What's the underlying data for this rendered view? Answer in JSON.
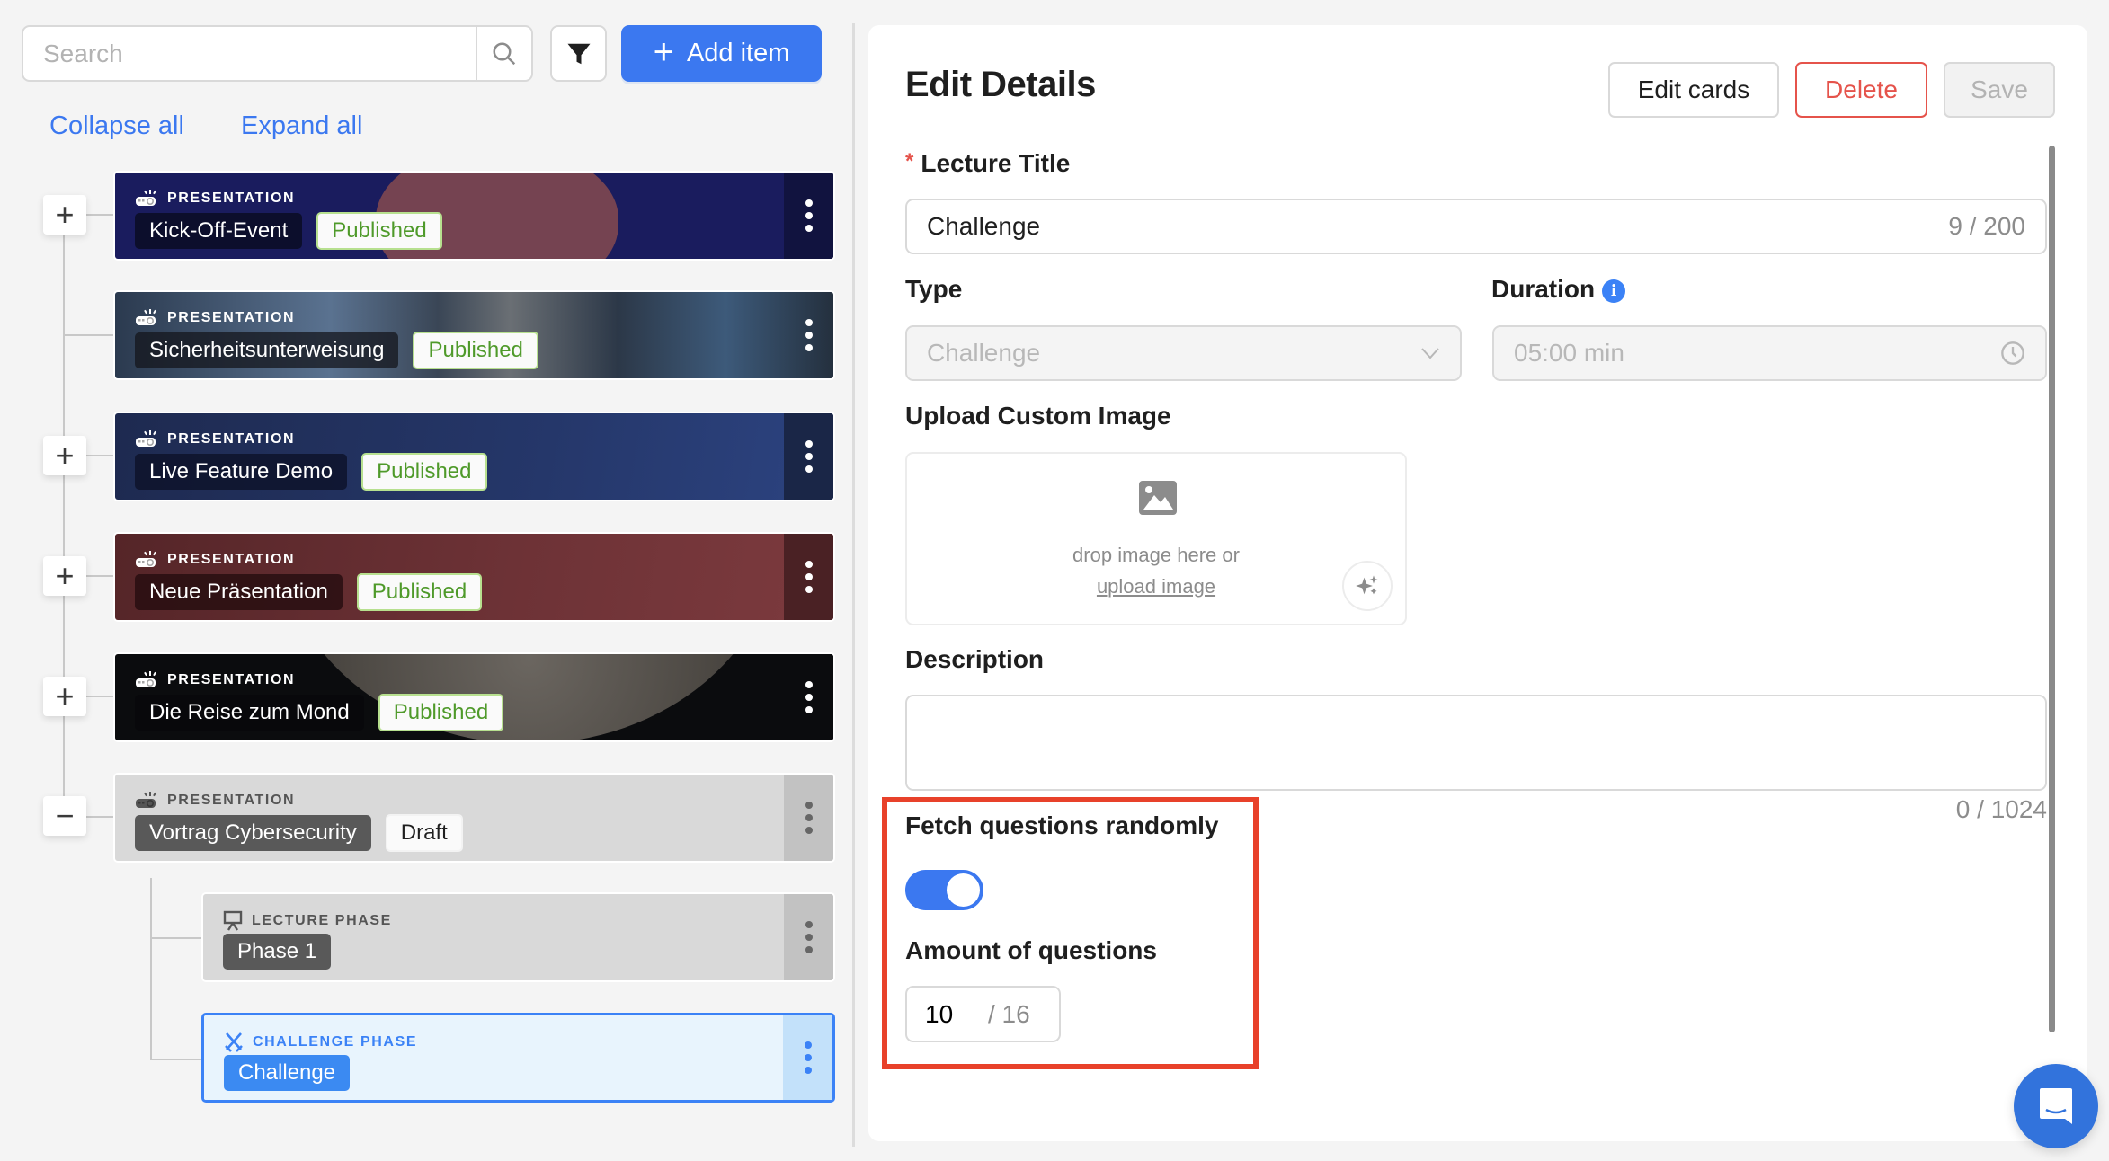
{
  "toolbar": {
    "search_placeholder": "Search",
    "search_value": "",
    "search_icon": "magnifier-icon",
    "filter_icon": "funnel-icon",
    "add_label": "Add item",
    "add_icon": "plus-icon"
  },
  "tree_actions": {
    "collapse_all": "Collapse all",
    "expand_all": "Expand all"
  },
  "colors": {
    "accent": "#3b78f0",
    "danger": "#e5534b",
    "published_text": "#4f9a2a",
    "highlight": "#e8412a"
  },
  "tree": {
    "items": [
      {
        "kind": "PRESENTATION",
        "icon": "projector-icon",
        "name": "Kick-Off-Event",
        "status": "Published",
        "expander": "+",
        "theme": "brain"
      },
      {
        "kind": "PRESENTATION",
        "icon": "projector-icon",
        "name": "Sicherheitsunterweisung",
        "status": "Published",
        "expander": "",
        "theme": "office"
      },
      {
        "kind": "PRESENTATION",
        "icon": "projector-icon",
        "name": "Live Feature Demo",
        "status": "Published",
        "expander": "+",
        "theme": "navy"
      },
      {
        "kind": "PRESENTATION",
        "icon": "projector-icon",
        "name": "Neue Präsentation",
        "status": "Published",
        "expander": "+",
        "theme": "maroon"
      },
      {
        "kind": "PRESENTATION",
        "icon": "projector-icon",
        "name": "Die Reise zum Mond",
        "status": "Published",
        "expander": "+",
        "theme": "moon"
      },
      {
        "kind": "PRESENTATION",
        "icon": "projector-icon",
        "name": "Vortrag Cybersecurity",
        "status": "Draft",
        "expander": "−",
        "theme": "gray"
      }
    ],
    "children": [
      {
        "kind": "LECTURE PHASE",
        "icon": "easel-icon",
        "name": "Phase 1"
      },
      {
        "kind": "CHALLENGE PHASE",
        "icon": "swords-icon",
        "name": "Challenge",
        "selected": true
      }
    ]
  },
  "detail": {
    "title": "Edit Details",
    "buttons": {
      "edit_cards": "Edit cards",
      "delete": "Delete",
      "save": "Save"
    },
    "lecture_title": {
      "label": "Lecture Title",
      "required_mark": "*",
      "value": "Challenge",
      "counter": "9 / 200"
    },
    "type": {
      "label": "Type",
      "value": "Challenge"
    },
    "duration": {
      "label": "Duration",
      "info": "i",
      "value": "05:00 min"
    },
    "upload": {
      "label": "Upload Custom Image",
      "hint": "drop image here or",
      "link": "upload image"
    },
    "description": {
      "label": "Description",
      "value": "",
      "counter": "0 / 1024"
    },
    "fetch_random": {
      "label": "Fetch questions randomly",
      "enabled": true
    },
    "amount": {
      "label": "Amount of questions",
      "value": "10",
      "max": "/ 16"
    }
  }
}
